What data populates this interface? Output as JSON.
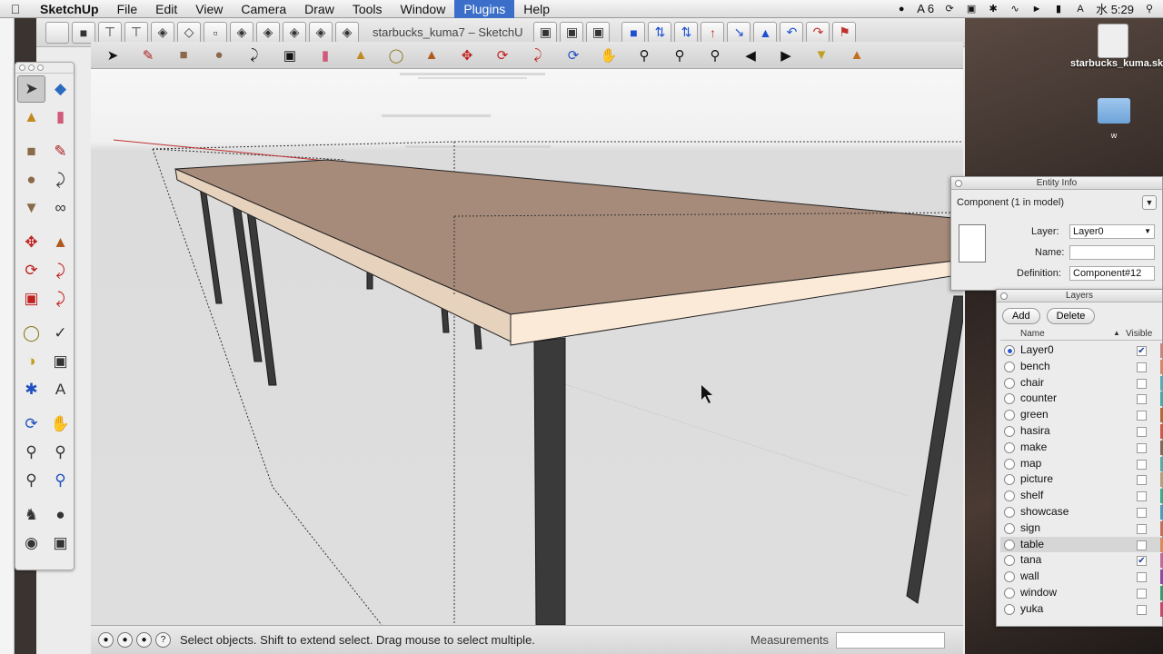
{
  "menubar": {
    "items": [
      "SketchUp",
      "File",
      "Edit",
      "View",
      "Camera",
      "Draw",
      "Tools",
      "Window",
      "Plugins",
      "Help"
    ],
    "status": {
      "badge": "6",
      "clock": "水 5:29"
    }
  },
  "window": {
    "title": "starbucks_kuma7 – SketchU"
  },
  "desktop": {
    "file_label": "starbucks_kuma.skp",
    "folder_label": "w"
  },
  "statusbar": {
    "text": "Select objects. Shift to extend select. Drag mouse to select multiple.",
    "measurements_label": "Measurements"
  },
  "entity_info": {
    "title": "Entity Info",
    "summary": "Component (1 in model)",
    "layer_label": "Layer:",
    "layer_value": "Layer0",
    "name_label": "Name:",
    "name_value": "",
    "definition_label": "Definition:",
    "definition_value": "Component#12"
  },
  "layers_panel": {
    "title": "Layers",
    "add_label": "Add",
    "delete_label": "Delete",
    "col_name": "Name",
    "col_visible": "Visible",
    "rows": [
      {
        "name": "Layer0",
        "current": true,
        "visible": true,
        "color": "#c2857a"
      },
      {
        "name": "bench",
        "current": false,
        "visible": false,
        "color": "#d0876a"
      },
      {
        "name": "chair",
        "current": false,
        "visible": false,
        "color": "#5aa9b5"
      },
      {
        "name": "counter",
        "current": false,
        "visible": false,
        "color": "#4ba6a6"
      },
      {
        "name": "green",
        "current": false,
        "visible": false,
        "color": "#b06a3a"
      },
      {
        "name": "hasira",
        "current": false,
        "visible": false,
        "color": "#c85a4a"
      },
      {
        "name": "make",
        "current": false,
        "visible": false,
        "color": "#7a6a5a"
      },
      {
        "name": "map",
        "current": false,
        "visible": false,
        "color": "#5aa8a0"
      },
      {
        "name": "picture",
        "current": false,
        "visible": false,
        "color": "#b0a07a"
      },
      {
        "name": "shelf",
        "current": false,
        "visible": false,
        "color": "#3aa88a"
      },
      {
        "name": "showcase",
        "current": false,
        "visible": false,
        "color": "#4a9aba"
      },
      {
        "name": "sign",
        "current": false,
        "visible": false,
        "color": "#c0705a"
      },
      {
        "name": "table",
        "current": false,
        "visible": false,
        "color": "#d88a5a"
      },
      {
        "name": "tana",
        "current": false,
        "visible": true,
        "color": "#c06a9a"
      },
      {
        "name": "wall",
        "current": false,
        "visible": false,
        "color": "#8a4aa0"
      },
      {
        "name": "window",
        "current": false,
        "visible": false,
        "color": "#3a9a6a"
      },
      {
        "name": "yuka",
        "current": false,
        "visible": false,
        "color": "#c04a6a"
      }
    ],
    "selected_row": "table"
  },
  "toolbar": {
    "row1_icons": [
      "blank-icon",
      "top-view-icon",
      "section-icon",
      "section-fill-icon",
      "paint-face-icon",
      "push-icon",
      "outer-shell-icon",
      "intersect-icon",
      "union-icon",
      "subtract-icon",
      "trim-icon",
      "split-icon"
    ],
    "row1_right_icons": [
      "box-iso-icon",
      "box-front-icon",
      "box-side-icon"
    ],
    "row1_far_icons": [
      "move-blue-icon",
      "align-icon",
      "flip-icon",
      "up-arrow-icon",
      "down-arrow-icon",
      "tilt-icon",
      "mirror-icon",
      "rotate-cw-icon",
      "rotate-ccw-icon",
      "flag-icon"
    ],
    "row2_icons": [
      "select-icon",
      "pencil-icon",
      "rectangle-icon",
      "circle-icon",
      "arc-icon",
      "box-push-icon",
      "eraser-icon",
      "paint-bucket-icon",
      "tape-icon",
      "push-pull-icon",
      "move-icon",
      "rotate-icon",
      "follow-me-icon",
      "orbit-icon",
      "pan-icon",
      "zoom-icon",
      "zoom-extents-icon",
      "zoom-window-icon",
      "previous-view-icon",
      "next-view-icon",
      "warehouse-icon",
      "share-icon"
    ]
  }
}
